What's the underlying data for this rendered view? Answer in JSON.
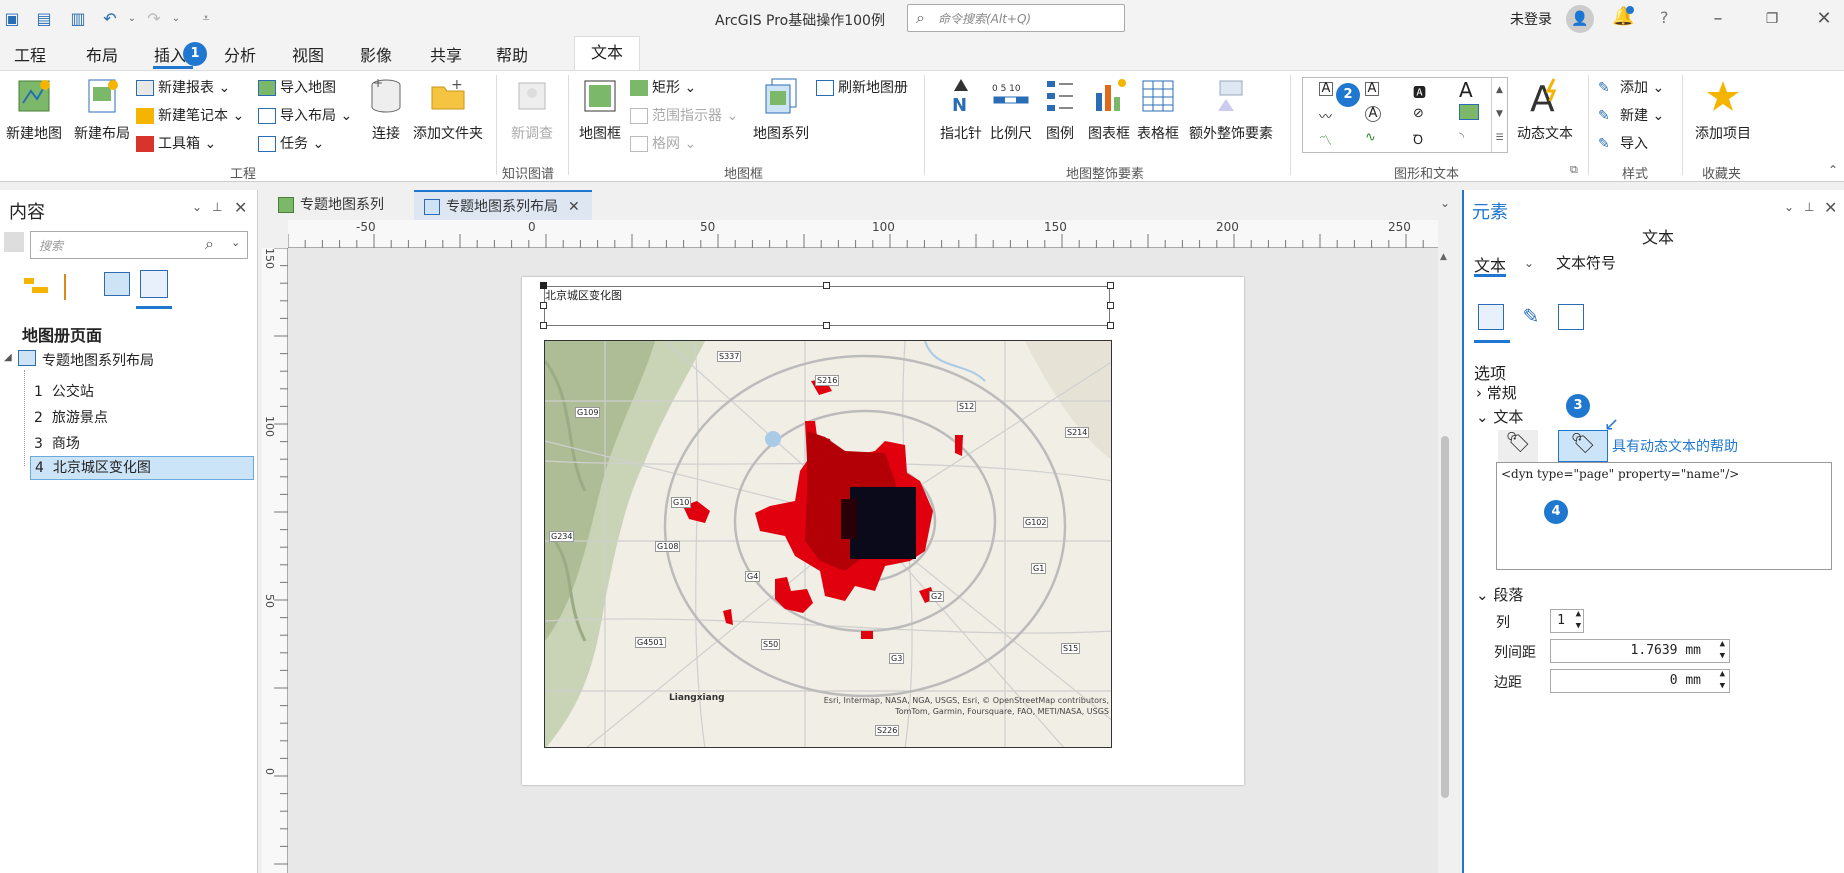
{
  "app": {
    "title": "ArcGIS Pro基础操作100例",
    "search_placeholder": "命令搜索(Alt+Q)",
    "user": "未登录"
  },
  "menu_tabs": [
    "工程",
    "布局",
    "插入",
    "分析",
    "视图",
    "影像",
    "共享",
    "帮助"
  ],
  "active_context_tab": "文本",
  "ribbon": {
    "project": {
      "new_map": "新建地图",
      "new_layout": "新建布局",
      "new_report": "新建报表",
      "new_notebook": "新建笔记本",
      "toolbox": "工具箱",
      "import_map": "导入地图",
      "import_layout": "导入布局",
      "task": "任务",
      "connect": "连接",
      "add_folder": "添加文件夹",
      "group": "工程"
    },
    "knowledge": {
      "new_survey": "新调查",
      "group": "知识图谱"
    },
    "mapframe": {
      "map_frame": "地图框",
      "rectangle": "矩形",
      "extent_indicator": "范围指示器",
      "grid": "格网",
      "map_series": "地图系列",
      "refresh_series": "刷新地图册",
      "group": "地图框"
    },
    "surround": {
      "north_arrow": "指北针",
      "scale_bar": "比例尺",
      "legend": "图例",
      "chart_frame": "图表框",
      "table_frame": "表格框",
      "extra_surround": "额外整饰要素",
      "group": "地图整饰要素",
      "scale_ticks": "0 5 10"
    },
    "graphics": {
      "dynamic_text": "动态文本",
      "group": "图形和文本"
    },
    "styles": {
      "add": "添加",
      "new": "新建",
      "import": "导入",
      "group": "样式"
    },
    "favorites": {
      "add_item": "添加项目",
      "group": "收藏夹"
    }
  },
  "badges": {
    "b1": "1",
    "b2": "2",
    "b3": "3",
    "b4": "4"
  },
  "contents": {
    "title": "内容",
    "search_placeholder": "搜索",
    "section": "地图册页面",
    "root": "专题地图系列布局",
    "pages": [
      {
        "num": "1",
        "name": "公交站"
      },
      {
        "num": "2",
        "name": "旅游景点"
      },
      {
        "num": "3",
        "name": "商场"
      },
      {
        "num": "4",
        "name": "北京城区变化图"
      }
    ]
  },
  "doc_tabs": [
    {
      "label": "专题地图系列"
    },
    {
      "label": "专题地图系列布局"
    }
  ],
  "ruler": {
    "h_labels": [
      "-50",
      "0",
      "50",
      "100",
      "150",
      "200",
      "250"
    ],
    "v_labels": [
      "150",
      "100",
      "50",
      "0"
    ]
  },
  "layout": {
    "title_text": "北京城区变化图",
    "map_labels": [
      "S337",
      "S216",
      "G109",
      "S12",
      "S214",
      "G108",
      "G102",
      "G4",
      "G1",
      "G2",
      "G4501",
      "S50",
      "G3",
      "S15",
      "S226",
      "G234",
      "G10"
    ],
    "place_label": "Liangxiang",
    "attribution": "Esri, Intermap, NASA, NGA, USGS, Esri, © OpenStreetMap contributors, TomTom, Garmin, Foursquare, FAO, METI/NASA, USGS"
  },
  "element_pane": {
    "title": "元素",
    "subtitle": "文本",
    "tab_text": "文本",
    "tab_symbol": "文本符号",
    "options": "选项",
    "general": "常规",
    "text_section": "文本",
    "dynamic_help": "具有动态文本的帮助",
    "text_value": "<dyn type=\"page\" property=\"name\"/>",
    "paragraph": "段落",
    "columns_label": "列",
    "columns_value": "1",
    "col_gap_label": "列间距",
    "col_gap_value": "1.7639 mm",
    "margin_label": "边距",
    "margin_value": "0 mm"
  },
  "colors": {
    "accent": "#1f77cf",
    "change_red": "#e0000e",
    "center_dark": "#0a0a1a"
  }
}
